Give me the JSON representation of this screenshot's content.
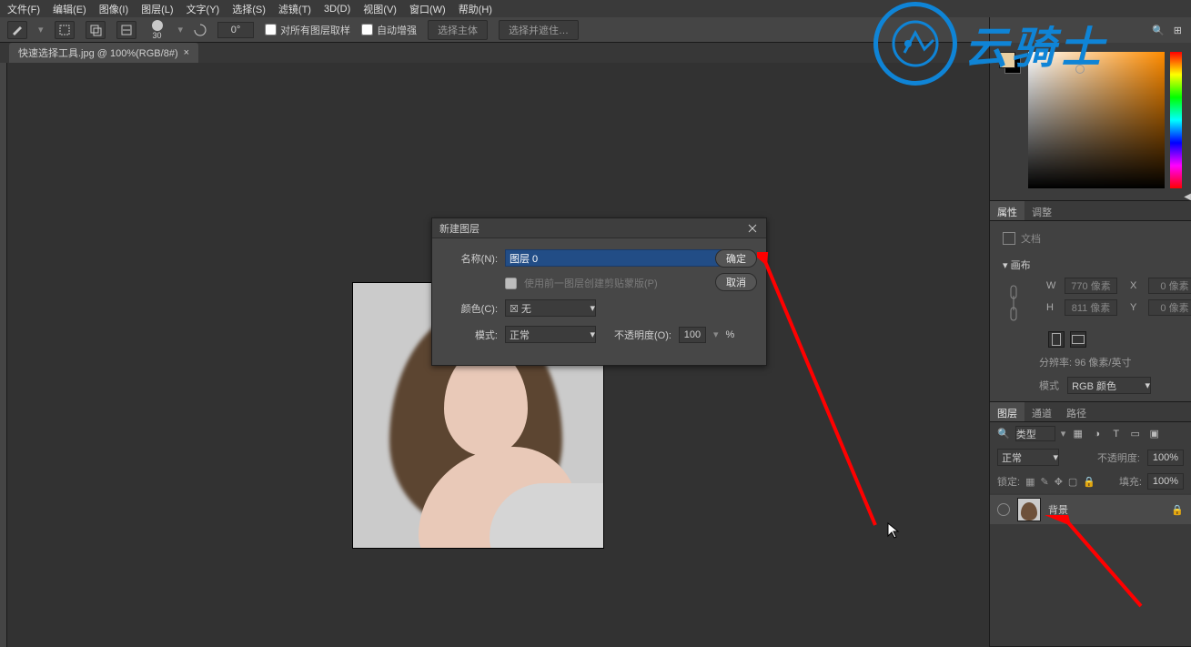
{
  "menu": {
    "items": [
      "文件(F)",
      "编辑(E)",
      "图像(I)",
      "图层(L)",
      "文字(Y)",
      "选择(S)",
      "滤镜(T)",
      "3D(D)",
      "视图(V)",
      "窗口(W)",
      "帮助(H)"
    ]
  },
  "optbar": {
    "brush_size": "30",
    "angle": "0°",
    "chk_sample_all": "对所有图层取样",
    "chk_auto_enhance": "自动增强",
    "btn_select_subject": "选择主体",
    "btn_select_and_mask": "选择并遮住…"
  },
  "tab": {
    "label": "快速选择工具.jpg @ 100%(RGB/8#)",
    "close": "×"
  },
  "dialog": {
    "title": "新建图层",
    "name_label": "名称(N):",
    "name_value": "图层 0",
    "clip_check": "使用前一图层创建剪贴蒙版(P)",
    "color_label": "颜色(C):",
    "color_value": "无",
    "mode_label": "模式:",
    "mode_value": "正常",
    "opacity_label": "不透明度(O):",
    "opacity_value": "100",
    "opacity_unit": "%",
    "ok": "确定",
    "cancel": "取消"
  },
  "panel_top_icons": {
    "search": "🔍",
    "grid": "⊞"
  },
  "properties": {
    "tab1": "属性",
    "tab2": "调整",
    "doc_label": "文档",
    "canvas_label": "画布",
    "W": "770 像素",
    "H": "811 像素",
    "X": "0 像素",
    "Y": "0 像素",
    "resolution": "分辨率: 96 像素/英寸",
    "mode_label": "模式",
    "mode_value": "RGB 颜色"
  },
  "layers": {
    "tab1": "图层",
    "tab2": "通道",
    "tab3": "路径",
    "filter_label": "类型",
    "blend_label": "正常",
    "opacity_label": "不透明度:",
    "opacity_value": "100%",
    "lock_label": "锁定:",
    "fill_label": "填充:",
    "fill_value": "100%",
    "item_name": "背景"
  },
  "watermark": {
    "text": "云骑士"
  }
}
